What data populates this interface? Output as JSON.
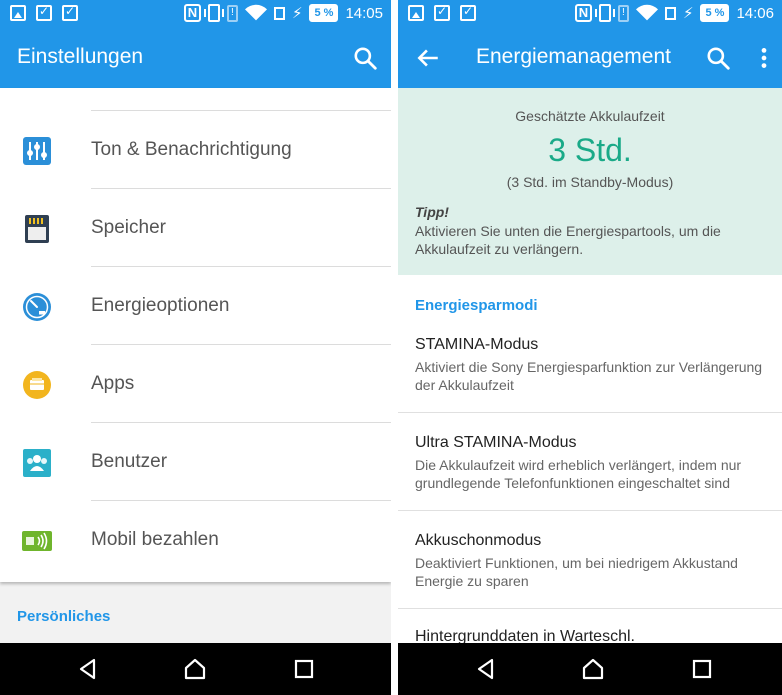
{
  "left": {
    "status_time": "14:05",
    "battery": "5 %",
    "title": "Einstellungen",
    "items": [
      {
        "label": "Ton & Benachrichtigung",
        "icon": "equalizer-icon"
      },
      {
        "label": "Speicher",
        "icon": "sd-card-icon"
      },
      {
        "label": "Energieoptionen",
        "icon": "gauge-icon"
      },
      {
        "label": "Apps",
        "icon": "apps-icon"
      },
      {
        "label": "Benutzer",
        "icon": "users-icon"
      },
      {
        "label": "Mobil bezahlen",
        "icon": "nfc-pay-icon"
      }
    ],
    "section_header": "Persönliches"
  },
  "right": {
    "status_time": "14:06",
    "battery": "5 %",
    "title": "Energiemanagement",
    "estimate": {
      "label": "Geschätzte Akkulaufzeit",
      "value": "3 Std.",
      "sub": "(3 Std. im Standby-Modus)"
    },
    "tip": {
      "title": "Tipp!",
      "text": "Aktivieren Sie unten die Energiespartools, um die Akkulaufzeit zu verlängern."
    },
    "section_header": "Energiesparmodi",
    "modes": [
      {
        "title": "STAMINA-Modus",
        "desc": "Aktiviert die Sony Energiesparfunktion zur Verlängerung der Akkulaufzeit"
      },
      {
        "title": "Ultra STAMINA-Modus",
        "desc": "Die Akkulaufzeit wird erheblich verlängert, indem nur grundlegende Telefonfunktionen eingeschaltet sind"
      },
      {
        "title": "Akkuschonmodus",
        "desc": "Deaktiviert Funktionen, um bei niedrigem Akkustand Energie zu sparen"
      },
      {
        "title": "Hintergrunddaten in Warteschl.",
        "desc": ""
      }
    ]
  },
  "colors": {
    "accent": "#2196e8",
    "estimate_value": "#1aaa88",
    "card_bg": "#ddf0ea"
  }
}
